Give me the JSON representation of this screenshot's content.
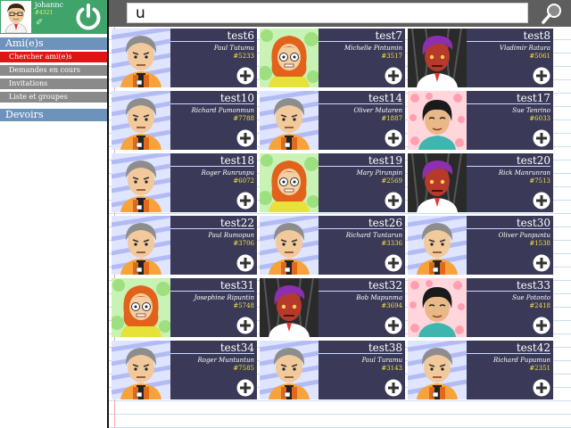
{
  "profile": {
    "username": "johannc",
    "user_id": "#4321",
    "edit_icon": "pencil-icon",
    "power_icon": "power-icon"
  },
  "sidebar": {
    "friends_label": "Ami(e)s",
    "items": [
      {
        "label": "Chercher ami(e)s",
        "active": true
      },
      {
        "label": "Demandes en cours",
        "active": false
      },
      {
        "label": "Invitations",
        "active": false
      },
      {
        "label": "Liste et groupes",
        "active": false
      }
    ],
    "homework_label": "Devoirs"
  },
  "search": {
    "value": "u",
    "icon": "magnifier-icon"
  },
  "colors": {
    "profile_bg": "#3fa36a",
    "section_head": "#6d93bd",
    "active_item": "#e01414",
    "card_bg": "#3a3a58",
    "friend_id": "#f1e03a"
  },
  "results": [
    {
      "username": "test6",
      "name": "Paul Tutumu",
      "id": "#5233",
      "avatar": "gray-boy"
    },
    {
      "username": "test7",
      "name": "Michelle Pintumin",
      "id": "#3517",
      "avatar": "orange-girl"
    },
    {
      "username": "test8",
      "name": "Vladimir Ratura",
      "id": "#5061",
      "avatar": "purple-dark"
    },
    {
      "username": "test10",
      "name": "Richard Pumonmun",
      "id": "#7788",
      "avatar": "gray-boy"
    },
    {
      "username": "test14",
      "name": "Oliver Mutaren",
      "id": "#1887",
      "avatar": "gray-boy"
    },
    {
      "username": "test17",
      "name": "Sue Tenrino",
      "id": "#6033",
      "avatar": "pink-girl"
    },
    {
      "username": "test18",
      "name": "Roger Runrunpu",
      "id": "#6072",
      "avatar": "gray-boy"
    },
    {
      "username": "test19",
      "name": "Mary Pirunpin",
      "id": "#2569",
      "avatar": "orange-girl"
    },
    {
      "username": "test20",
      "name": "Rick Manrunran",
      "id": "#7513",
      "avatar": "purple-dark"
    },
    {
      "username": "test22",
      "name": "Paul Rumopun",
      "id": "#3706",
      "avatar": "gray-boy"
    },
    {
      "username": "test26",
      "name": "Richard Tuntarun",
      "id": "#3336",
      "avatar": "gray-boy"
    },
    {
      "username": "test30",
      "name": "Oliver Punpuntu",
      "id": "#1538",
      "avatar": "gray-boy"
    },
    {
      "username": "test31",
      "name": "Josephine Ripuntin",
      "id": "#5748",
      "avatar": "orange-girl"
    },
    {
      "username": "test32",
      "name": "Bob Mapunma",
      "id": "#3694",
      "avatar": "purple-dark"
    },
    {
      "username": "test33",
      "name": "Sue Potonto",
      "id": "#2418",
      "avatar": "pink-girl"
    },
    {
      "username": "test34",
      "name": "Roger Muntuntun",
      "id": "#7585",
      "avatar": "gray-boy"
    },
    {
      "username": "test38",
      "name": "Paul Turamu",
      "id": "#3143",
      "avatar": "gray-boy"
    },
    {
      "username": "test42",
      "name": "Richard Pupumun",
      "id": "#2351",
      "avatar": "gray-boy"
    }
  ]
}
